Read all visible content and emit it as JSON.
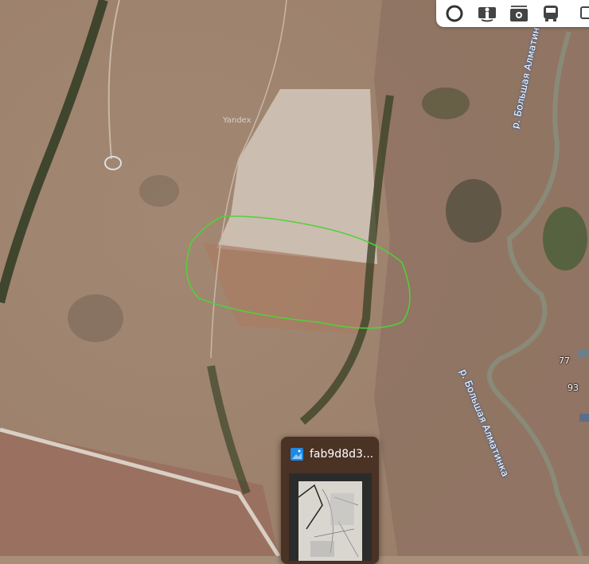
{
  "map": {
    "watermark": "Yandex",
    "river_label_top": "р. Большая Алматинка",
    "river_label_bottom": "р. Большая Алматинка",
    "house_numbers": [
      "77",
      "93"
    ],
    "colors": {
      "terrain": "#a88f7a",
      "field": "#cbbdb0",
      "outline": "#4fd23a",
      "river": "#8a8a78"
    }
  },
  "toolbar": {
    "buttons": [
      {
        "icon": "layers-circle-icon"
      },
      {
        "icon": "panorama-person-icon"
      },
      {
        "icon": "camera-icon"
      },
      {
        "icon": "bus-icon"
      },
      {
        "icon": "more-icon"
      }
    ]
  },
  "taskbar_preview": {
    "title": "fab9d8d3...",
    "app_icon": "photos-app-icon"
  }
}
